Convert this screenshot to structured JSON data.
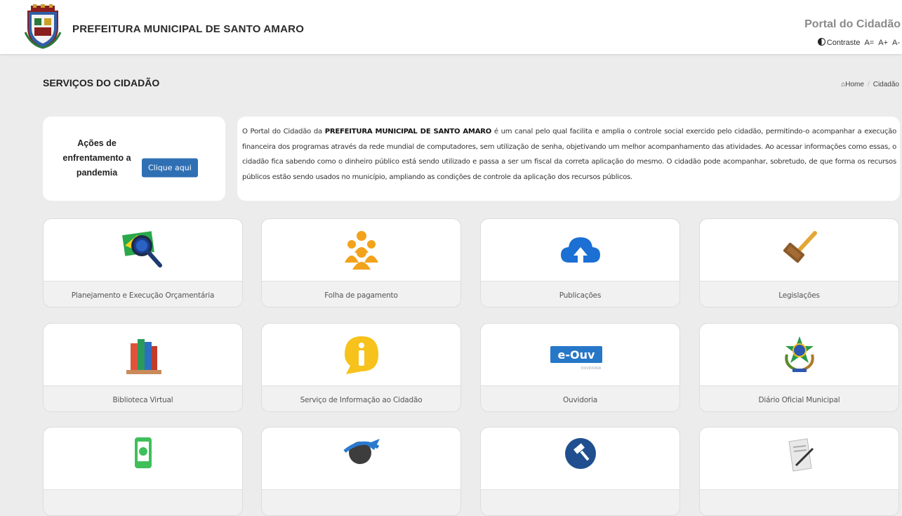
{
  "header": {
    "site_title": "PREFEITURA MUNICIPAL DE SANTO AMARO",
    "portal_title": "Portal do Cidadão",
    "accessibility": {
      "contrast": "Contraste",
      "font_reset": "A=",
      "font_increase": "A+",
      "font_decrease": "A-"
    }
  },
  "page": {
    "title": "SERVIÇOS DO CIDADÃO",
    "breadcrumb": {
      "home": "Home",
      "sep": "/",
      "current": "Cidadão"
    }
  },
  "covid_card": {
    "text": "Ações de enfrentamento a pandemia",
    "button": "Clique aqui"
  },
  "intro": {
    "p1": "O Portal do Cidadão da ",
    "bold": "PREFEITURA MUNICIPAL DE SANTO AMARO",
    "p2": " é um canal pelo qual facilita e amplia o controle social exercido pelo cidadão, permitindo-o acompanhar a execução financeira dos programas através da rede mundial de computadores, sem utilização de senha, objetivando um melhor acompanhamento das atividades. Ao acessar informações como essas, o cidadão fica sabendo como o dinheiro público está sendo utilizado e passa a ser um fiscal da correta aplicação do mesmo. O cidadão pode acompanhar, sobretudo, de que forma os recursos públicos estão sendo usados no município, ampliando as condições de controle da aplicação dos recursos públicos."
  },
  "tiles": [
    {
      "label": "Planejamento e Execução Orçamentária",
      "icon": "brazil-magnifier-icon"
    },
    {
      "label": "Folha de pagamento",
      "icon": "people-group-icon"
    },
    {
      "label": "Publicações",
      "icon": "cloud-upload-icon"
    },
    {
      "label": "Legislações",
      "icon": "gavel-icon"
    },
    {
      "label": "Biblioteca Virtual",
      "icon": "books-icon"
    },
    {
      "label": "Serviço de Informação ao Cidadão",
      "icon": "info-bubble-icon"
    },
    {
      "label": "Ouvidoria",
      "icon": "e-ouv-logo-icon",
      "badge": "e-Ouv",
      "badge_sub": "OUVIDORIA"
    },
    {
      "label": "Diário Oficial Municipal",
      "icon": "brazil-coat-of-arms-icon"
    },
    {
      "label": "",
      "icon": "money-phone-icon"
    },
    {
      "label": "",
      "icon": "travel-airplane-icon"
    },
    {
      "label": "",
      "icon": "auction-gavel-icon"
    },
    {
      "label": "",
      "icon": "document-pen-icon"
    }
  ],
  "colors": {
    "accent_blue": "#2f6fb3",
    "icon_orange": "#f3a21c",
    "icon_blue": "#1c6fd3",
    "icon_yellow": "#f6c21b",
    "icon_green": "#3fbf5a",
    "ouv_blue": "#2677c8"
  }
}
